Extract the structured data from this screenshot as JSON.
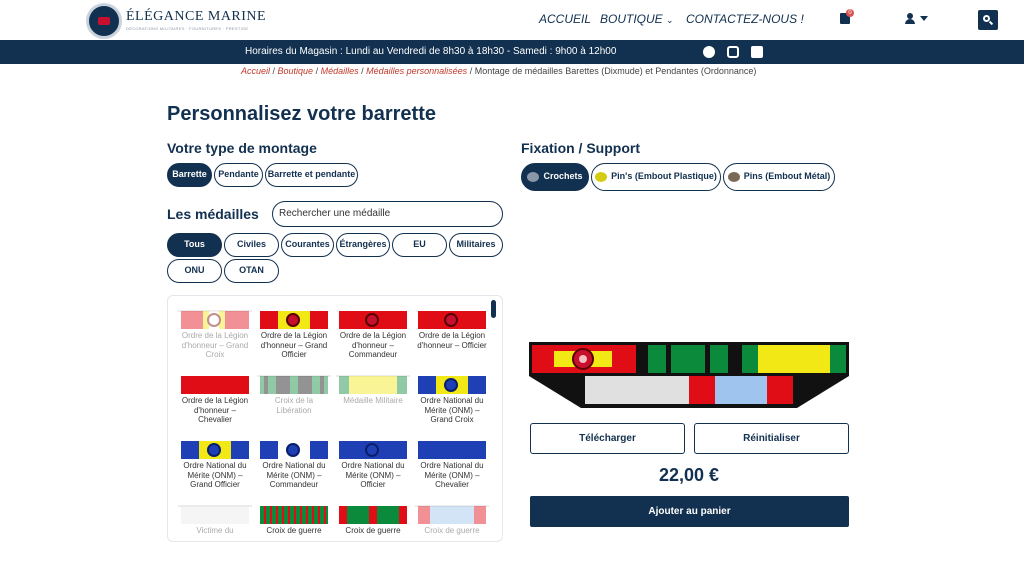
{
  "header": {
    "brand": "ÉLÉGANCE MARINE",
    "brand_tagline": "DÉCORATIONS MILITAIRES · FOURNITURES · PRESTIGE",
    "nav": [
      "ACCUEIL",
      "BOUTIQUE",
      "CONTACTEZ-NOUS !"
    ],
    "cart_count": "0"
  },
  "topbar": {
    "hours": "Horaires du Magasin : Lundi au Vendredi de 8h30 à 18h30 - Samedi : 9h00 à 12h00"
  },
  "breadcrumb": {
    "links": [
      "Accueil",
      "Boutique",
      "Médailles",
      "Médailles personnalisées"
    ],
    "current": "Montage de médailles Barettes (Dixmude) et Pendantes (Ordonnance)",
    "sep": " / "
  },
  "title": "Personnalisez votre barrette",
  "mount": {
    "heading": "Votre type de montage",
    "options": [
      "Barrette",
      "Pendante",
      "Barrette et pendante"
    ],
    "selected": "Barrette"
  },
  "fixation": {
    "heading": "Fixation / Support",
    "options": [
      "Crochets",
      "Pin's (Embout Plastique)",
      "Pins (Embout Métal)"
    ],
    "selected": "Crochets"
  },
  "medals": {
    "heading": "Les médailles",
    "search_placeholder": "Rechercher une médaille",
    "filters": [
      "Tous",
      "Civiles",
      "Courantes",
      "Étrangères",
      "EU",
      "Militaires",
      "ONU",
      "OTAN"
    ],
    "selected_filter": "Tous",
    "items": [
      {
        "label": "Ordre de la Légion d'honneur – Grand Croix",
        "dim": true
      },
      {
        "label": "Ordre de la Légion d'honneur – Grand Officier",
        "dim": false
      },
      {
        "label": "Ordre de la Légion d'honneur – Commandeur",
        "dim": false
      },
      {
        "label": "Ordre de la Légion d'honneur – Officier",
        "dim": false
      },
      {
        "label": "Ordre de la Légion d'honneur – Chevalier",
        "dim": false
      },
      {
        "label": "Croix de la Libération",
        "dim": true
      },
      {
        "label": "Médaille Militaire",
        "dim": true
      },
      {
        "label": "Ordre National du Mérite (ONM) – Grand Croix",
        "dim": false
      },
      {
        "label": "Ordre National du Mérite (ONM) – Grand Officier",
        "dim": false
      },
      {
        "label": "Ordre National du Mérite (ONM) – Commandeur",
        "dim": false
      },
      {
        "label": "Ordre National du Mérite (ONM) – Officier",
        "dim": false
      },
      {
        "label": "Ordre National du Mérite (ONM) – Chevalier",
        "dim": false
      },
      {
        "label": "Victime du",
        "dim": true
      },
      {
        "label": "Croix de guerre",
        "dim": false
      },
      {
        "label": "Croix de guerre",
        "dim": false
      },
      {
        "label": "Croix de guerre",
        "dim": true
      }
    ]
  },
  "actions": {
    "download": "Télécharger",
    "reset": "Réinitialiser",
    "price": "22,00 €",
    "add_to_cart": "Ajouter au panier"
  },
  "colors": {
    "navy": "#12304f",
    "red": "#e10d16",
    "blue": "#1f3fb4",
    "green": "#0b8a3b",
    "yellow": "#f2e816"
  }
}
